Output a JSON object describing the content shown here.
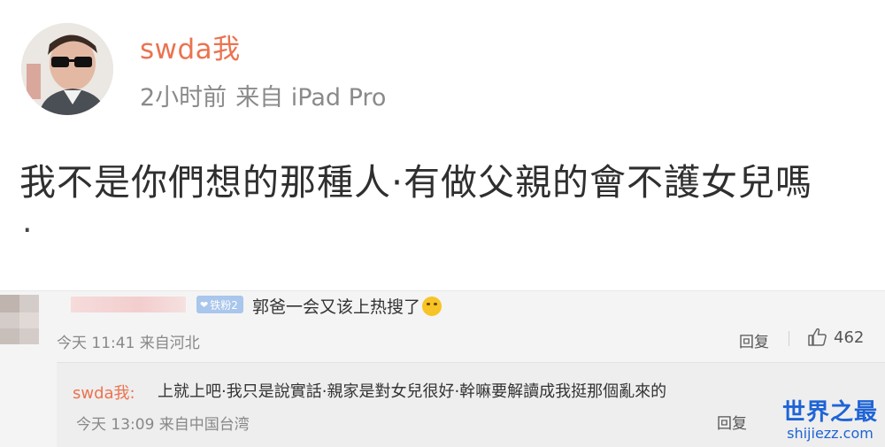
{
  "post": {
    "username": "swda我",
    "time": "2小时前",
    "source": "来自 iPad Pro",
    "text": "我不是你們想的那種人·有做父親的會不護女兒嗎",
    "text_tail": "·"
  },
  "comment": {
    "badge_label": "铁粉2",
    "text": "郭爸一会又该上热搜了",
    "meta": "今天 11:41 来自河北",
    "reply_label": "回复",
    "like_count": "462"
  },
  "reply": {
    "username": "swda我:",
    "text": "上就上吧·我只是說實話·親家是對女兒很好·幹嘛要解讀成我挺那個亂來的",
    "meta": "今天 13:09 来自中国台湾",
    "reply_label": "回复"
  },
  "watermark": {
    "line1": "世界之最",
    "line2": "shijiezz.com"
  },
  "colors": {
    "accent_orange": "#eb7350",
    "watermark_blue": "#1e64d6",
    "badge_blue": "#a9c6ec"
  }
}
